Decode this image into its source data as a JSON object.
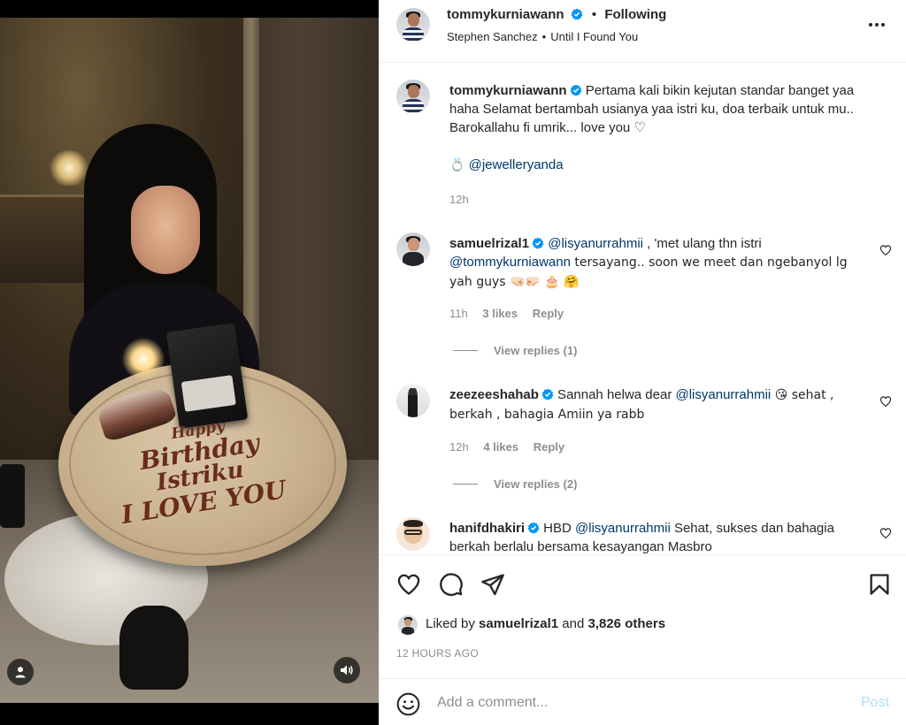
{
  "media": {
    "plate_text": [
      "Happy",
      "Birthday",
      "Istriku",
      "I LOVE YOU"
    ]
  },
  "header": {
    "username": "tommykurniawann",
    "dot": "•",
    "follow_label": "Following",
    "artist": "Stephen Sanchez",
    "separator": "•",
    "song": "Until I Found You"
  },
  "caption": {
    "username": "tommykurniawann",
    "text": "Pertama kali bikin kejutan standar banget yaa haha Selamat bertambah usianya yaa istri ku, doa terbaik untuk mu.. Barokallahu fi umrik... love you ♡",
    "mention_emoji": "💍",
    "mention": "@jewelleryanda",
    "time": "12h"
  },
  "comments": [
    {
      "username": "samuelrizal1",
      "mention1": "@lisyanurrahmii",
      "text1": " , 'met ulang thn istri ",
      "mention2": "@tommykurniawann",
      "text2": " tersayang.. soon we meet dan ngebanyol lg yah guys 🤜🏻🤛🏻 🎂 🤗",
      "time": "11h",
      "likes": "3 likes",
      "reply": "Reply",
      "view_replies": "View replies (1)"
    },
    {
      "username": "zeezeeshahab",
      "text1": " Sannah helwa dear ",
      "mention1": "@lisyanurrahmii",
      "text2": " 😘 sehat , berkah , bahagia Amiin ya rabb",
      "time": "12h",
      "likes": "4 likes",
      "reply": "Reply",
      "view_replies": "View replies (2)"
    },
    {
      "username": "hanifdhakiri",
      "text1": " HBD ",
      "mention1": "@lisyanurrahmii",
      "text2": " Sehat, sukses dan bahagia berkah berlalu bersama kesayangan Masbro"
    }
  ],
  "likes": {
    "prefix": "Liked by ",
    "user": "samuelrizal1",
    "middle": " and ",
    "count": "3,826 others"
  },
  "timestamp": "12 HOURS AGO",
  "comment_box": {
    "placeholder": "Add a comment...",
    "post_label": "Post"
  },
  "colors": {
    "verified": "#0095f6",
    "mention": "#00376b",
    "muted": "#8e8e8e",
    "post_disabled": "#b2dffc"
  }
}
